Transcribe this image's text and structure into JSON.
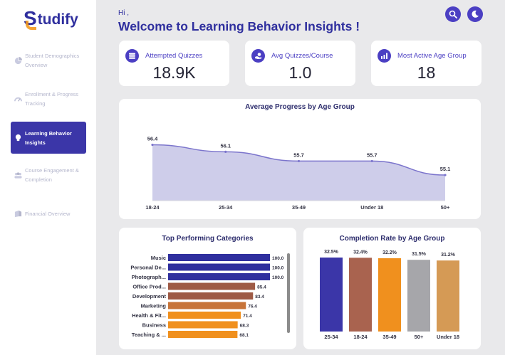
{
  "sidebar": {
    "logo_initial": "S",
    "logo_rest": "tudify",
    "items": [
      {
        "label": "Student Demographics Overview",
        "icon": "pie-chart-icon",
        "active": false
      },
      {
        "label": "Enrollment & Progress Tracking",
        "icon": "progress-gauge-icon",
        "active": false
      },
      {
        "label": "Learning Behavior Insights",
        "icon": "brain-bulb-icon",
        "active": true
      },
      {
        "label": "Course Engagement & Completion",
        "icon": "group-icon",
        "active": false
      },
      {
        "label": "Financial Overview",
        "icon": "finance-icon",
        "active": false
      }
    ]
  },
  "header": {
    "greeting": "Hi ,",
    "title": "Welcome to Learning Behavior Insights !",
    "search_icon": "search-icon",
    "theme_icon": "moon-icon"
  },
  "kpis": [
    {
      "title": "Attempted Quizzes",
      "value": "18.9K",
      "icon": "quiz-stack-icon"
    },
    {
      "title": "Avg Quizzes/Course",
      "value": "1.0",
      "icon": "hand-coin-icon"
    },
    {
      "title": "Most Active Age Group",
      "value": "18",
      "icon": "bar-growth-icon"
    }
  ],
  "colors": {
    "primary": "#3b36a8",
    "accent": "#4b3fc3",
    "area_fill": "#c9c8e8",
    "area_line": "#7b74cc"
  },
  "chart_data": [
    {
      "type": "area",
      "title": "Average Progress by Age Group",
      "categories": [
        "18-24",
        "25-34",
        "35-49",
        "Under 18",
        "50+"
      ],
      "values": [
        56.4,
        56.1,
        55.7,
        55.7,
        55.1
      ],
      "labels": [
        "56.4",
        "56.1",
        "55.7",
        "55.7",
        "55.1"
      ],
      "ylim": [
        54.0,
        56.6
      ],
      "grid": false
    },
    {
      "type": "bar",
      "orientation": "horizontal",
      "title": "Top Performing Categories",
      "categories": [
        "Music",
        "Personal De...",
        "Photograph...",
        "Office Prod...",
        "Development",
        "Marketing",
        "Health & Fit...",
        "Business",
        "Teaching & ..."
      ],
      "values": [
        100.0,
        100.0,
        100.0,
        85.4,
        83.4,
        76.4,
        71.4,
        68.3,
        68.1
      ],
      "labels": [
        "100.0",
        "100.0",
        "100.0",
        "85.4",
        "83.4",
        "76.4",
        "71.4",
        "68.3",
        "68.1"
      ],
      "colors": [
        "#2f2f9e",
        "#2f2f9e",
        "#2f2f9e",
        "#9e5a45",
        "#9e5a45",
        "#c7743a",
        "#f0901e",
        "#f0901e",
        "#f0901e"
      ],
      "xlim": [
        0,
        100
      ]
    },
    {
      "type": "bar",
      "title": "Completion Rate by Age Group",
      "categories": [
        "25-34",
        "18-24",
        "35-49",
        "50+",
        "Under 18"
      ],
      "values": [
        32.5,
        32.4,
        32.2,
        31.5,
        31.2
      ],
      "labels": [
        "32.5%",
        "32.4%",
        "32.2%",
        "31.5%",
        "31.2%"
      ],
      "colors": [
        "#3b36a8",
        "#a9634f",
        "#f0901e",
        "#a6a6aa",
        "#d59a55"
      ],
      "ylim": [
        0,
        32.5
      ]
    }
  ]
}
